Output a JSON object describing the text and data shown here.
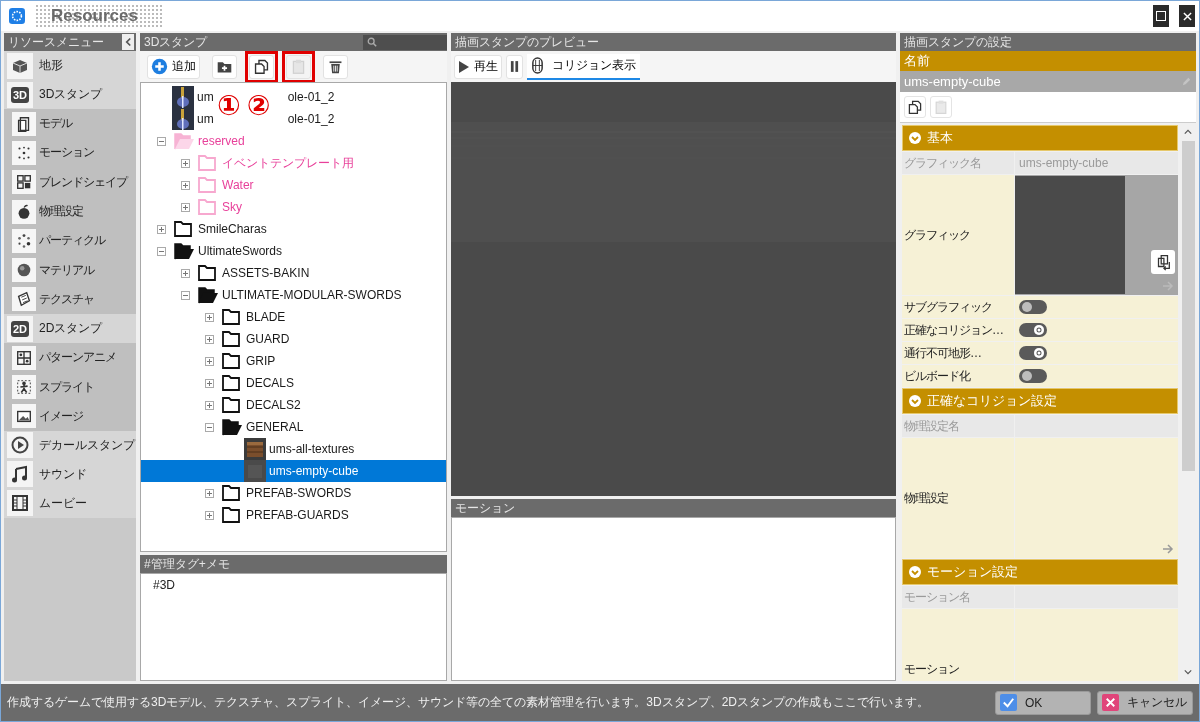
{
  "window": {
    "title": "Resources"
  },
  "resource_menu": {
    "title": "リソースメニュー",
    "items": [
      {
        "label": "地形"
      },
      {
        "label": "3Dスタンプ",
        "badge": "3D",
        "children": [
          {
            "label": "モデル"
          },
          {
            "label": "モーション"
          },
          {
            "label": "ブレンドシェイプ"
          },
          {
            "label": "物理設定"
          },
          {
            "label": "パーティクル"
          },
          {
            "label": "マテリアル"
          },
          {
            "label": "テクスチャ"
          }
        ]
      },
      {
        "label": "2Dスタンプ",
        "badge": "2D",
        "children": [
          {
            "label": "パターンアニメ"
          },
          {
            "label": "スプライト"
          },
          {
            "label": "イメージ"
          }
        ]
      },
      {
        "label": "デカールスタンプ"
      },
      {
        "label": "サウンド"
      },
      {
        "label": "ムービー"
      }
    ]
  },
  "stamp_tree": {
    "title": "3Dスタンプ",
    "tools": [
      {
        "kind": "add",
        "label": "追加",
        "disabled": false,
        "highlighted": false
      },
      {
        "kind": "new-folder",
        "disabled": false,
        "highlighted": false
      },
      {
        "kind": "copy",
        "disabled": false,
        "highlighted": true
      },
      {
        "kind": "paste",
        "disabled": true,
        "highlighted": true
      },
      {
        "kind": "delete",
        "disabled": false,
        "highlighted": false
      }
    ],
    "annotations": [
      "①",
      "②"
    ],
    "nodes": [
      {
        "kind": "item",
        "label_start": "um",
        "label_end": "ole-01_2",
        "selected": false
      },
      {
        "kind": "item",
        "label_start": "um",
        "label_end": "ole-01_2",
        "selected": false
      },
      {
        "kind": "folder",
        "label": "reserved",
        "expanded": true,
        "selected": false,
        "color": "#e8409a",
        "children": [
          {
            "kind": "folder",
            "label": "イベントテンプレート用",
            "expanded": false,
            "selected": false,
            "color": "#e8409a"
          },
          {
            "kind": "folder",
            "label": "Water",
            "expanded": false,
            "selected": false,
            "color": "#e8409a"
          },
          {
            "kind": "folder",
            "label": "Sky",
            "expanded": false,
            "selected": false,
            "color": "#e8409a"
          }
        ]
      },
      {
        "kind": "folder",
        "label": "SmileCharas",
        "expanded": false,
        "selected": false
      },
      {
        "kind": "folder",
        "label": "UltimateSwords",
        "expanded": true,
        "selected": false,
        "children": [
          {
            "kind": "folder",
            "label": "ASSETS-BAKIN",
            "expanded": false,
            "selected": false
          },
          {
            "kind": "folder",
            "label": "ULTIMATE-MODULAR-SWORDS",
            "expanded": true,
            "selected": false,
            "children": [
              {
                "kind": "folder",
                "label": "BLADE",
                "expanded": false,
                "selected": false
              },
              {
                "kind": "folder",
                "label": "GUARD",
                "expanded": false,
                "selected": false
              },
              {
                "kind": "folder",
                "label": "GRIP",
                "expanded": false,
                "selected": false
              },
              {
                "kind": "folder",
                "label": "DECALS",
                "expanded": false,
                "selected": false
              },
              {
                "kind": "folder",
                "label": "DECALS2",
                "expanded": false,
                "selected": false
              },
              {
                "kind": "folder",
                "label": "GENERAL",
                "expanded": true,
                "selected": false,
                "children": [
                  {
                    "kind": "item",
                    "label": "ums-all-textures",
                    "selected": false
                  },
                  {
                    "kind": "item",
                    "label": "ums-empty-cube",
                    "selected": true
                  }
                ]
              },
              {
                "kind": "folder",
                "label": "PREFAB-SWORDS",
                "expanded": false,
                "selected": false
              },
              {
                "kind": "folder",
                "label": "PREFAB-GUARDS",
                "expanded": false,
                "selected": false
              }
            ]
          }
        ]
      }
    ]
  },
  "tag_memo": {
    "title": "#管理タグ+メモ",
    "text": "#3D"
  },
  "preview": {
    "title": "描画スタンプのプレビュー",
    "play_label": "再生",
    "collision": {
      "label": "コリジョン表示",
      "selected": true
    }
  },
  "motion_panel": {
    "title": "モーション"
  },
  "settings": {
    "title": "描画スタンプの設定",
    "name_label": "名前",
    "name_value": "ums-empty-cube",
    "sections": [
      {
        "title": "基本",
        "expanded": true,
        "rows": [
          {
            "kind": "text",
            "label": "グラフィック名",
            "value": "ums-empty-cube"
          },
          {
            "kind": "graphic",
            "label": "グラフィック"
          },
          {
            "kind": "toggle",
            "label": "サブグラフィック",
            "on": false
          },
          {
            "kind": "toggle",
            "label": "正確なコリジョン…",
            "on": true
          },
          {
            "kind": "toggle",
            "label": "通行不可地形…",
            "on": true
          },
          {
            "kind": "toggle",
            "label": "ビルボード化",
            "on": false
          }
        ]
      },
      {
        "title": "正確なコリジョン設定",
        "expanded": true,
        "rows": [
          {
            "kind": "text",
            "label": "物理設定名"
          },
          {
            "kind": "link",
            "label": "物理設定"
          }
        ]
      },
      {
        "title": "モーション設定",
        "expanded": true,
        "rows": [
          {
            "kind": "text",
            "label": "モーション名"
          },
          {
            "kind": "tall",
            "label": "モーション"
          }
        ]
      }
    ]
  },
  "status_bar": {
    "text": "作成するゲームで使用する3Dモデル、テクスチャ、スプライト、イメージ、サウンド等の全ての素材管理を行います。3Dスタンプ、2Dスタンプの作成もここで行います。",
    "ok": "OK",
    "cancel": "キャンセル"
  }
}
